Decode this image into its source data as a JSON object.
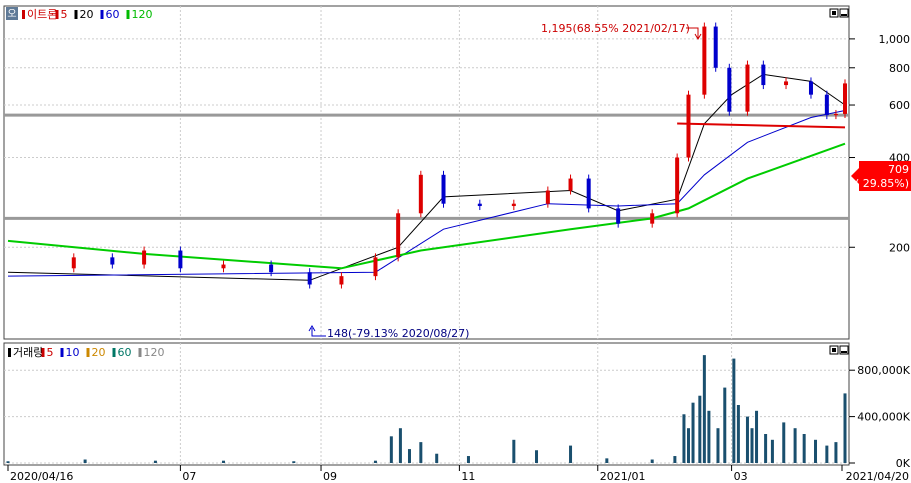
{
  "price_panel": {
    "badge": "오",
    "legend": [
      {
        "label": "이트론",
        "color": "#cc0000"
      },
      {
        "label": "5",
        "color": "#cc0000"
      },
      {
        "label": "20",
        "color": "#000000"
      },
      {
        "label": "60",
        "color": "#0000cc"
      },
      {
        "label": "120",
        "color": "#00bb00"
      }
    ],
    "current_price": "709",
    "current_change": "( 29.85%)",
    "high_annotation": "1,195(68.55% 2021/02/17)",
    "low_annotation": "148(-79.13% 2020/08/27)"
  },
  "volume_panel": {
    "legend": [
      {
        "label": "거래량",
        "color": "#000000"
      },
      {
        "label": "5",
        "color": "#cc0000"
      },
      {
        "label": "10",
        "color": "#0000cc"
      },
      {
        "label": "20",
        "color": "#cc8800"
      },
      {
        "label": "60",
        "color": "#007766"
      },
      {
        "label": "120",
        "color": "#888888"
      }
    ]
  },
  "x_axis_labels": [
    "2020/04/16",
    "07",
    "09",
    "11",
    "2021/01",
    "03",
    "2021/04/20"
  ],
  "colors": {
    "up": "#dd0000",
    "down": "#0000cc",
    "ma5": "#dd0000",
    "ma20": "#000000",
    "ma60": "#0000cc",
    "ma120": "#00cc00",
    "volume_bar": "#1a4f6e",
    "horizontal_line": "#999999"
  },
  "chart_data": [
    {
      "type": "candlestick",
      "title": "이트론",
      "ylim": [
        100,
        1250
      ],
      "yticks": [
        200,
        400,
        600,
        800,
        1000
      ],
      "ytick_labels": [
        "200",
        "400",
        "600",
        "800",
        "1,000"
      ],
      "horizontal_lines": [
        555,
        250
      ],
      "series_close": [
        [
          "2020/04/16",
          170
        ],
        [
          "2020/05/15",
          185
        ],
        [
          "2020/06/01",
          175
        ],
        [
          "2020/06/15",
          195
        ],
        [
          "2020/07/01",
          170
        ],
        [
          "2020/07/20",
          175
        ],
        [
          "2020/08/10",
          165
        ],
        [
          "2020/08/27",
          150
        ],
        [
          "2020/09/10",
          160
        ],
        [
          "2020/09/25",
          185
        ],
        [
          "2020/10/05",
          260
        ],
        [
          "2020/10/15",
          350
        ],
        [
          "2020/10/25",
          280
        ],
        [
          "2020/11/10",
          275
        ],
        [
          "2020/11/25",
          280
        ],
        [
          "2020/12/10",
          310
        ],
        [
          "2020/12/20",
          340
        ],
        [
          "2020/12/28",
          270
        ],
        [
          "2021/01/10",
          240
        ],
        [
          "2021/01/25",
          260
        ],
        [
          "2021/02/05",
          400
        ],
        [
          "2021/02/10",
          650
        ],
        [
          "2021/02/17",
          1100
        ],
        [
          "2021/02/22",
          800
        ],
        [
          "2021/02/28",
          570
        ],
        [
          "2021/03/08",
          820
        ],
        [
          "2021/03/15",
          700
        ],
        [
          "2021/03/25",
          720
        ],
        [
          "2021/04/05",
          650
        ],
        [
          "2021/04/12",
          555
        ],
        [
          "2021/04/16",
          560
        ],
        [
          "2021/04/20",
          709
        ]
      ],
      "moving_averages": [
        {
          "name": "20",
          "points": [
            [
              "2020/04/16",
              165
            ],
            [
              "2020/08/27",
              155
            ],
            [
              "2020/10/05",
              200
            ],
            [
              "2020/10/25",
              295
            ],
            [
              "2020/12/20",
              310
            ],
            [
              "2021/01/10",
              265
            ],
            [
              "2021/02/05",
              290
            ],
            [
              "2021/02/17",
              520
            ],
            [
              "2021/03/01",
              650
            ],
            [
              "2021/03/15",
              760
            ],
            [
              "2021/04/05",
              720
            ],
            [
              "2021/04/20",
              600
            ]
          ]
        },
        {
          "name": "60",
          "points": [
            [
              "2020/04/16",
              160
            ],
            [
              "2020/09/25",
              165
            ],
            [
              "2020/10/25",
              230
            ],
            [
              "2020/12/10",
              280
            ],
            [
              "2021/01/10",
              275
            ],
            [
              "2021/02/05",
              280
            ],
            [
              "2021/02/17",
              350
            ],
            [
              "2021/03/08",
              450
            ],
            [
              "2021/04/05",
              545
            ],
            [
              "2021/04/20",
              575
            ]
          ]
        },
        {
          "name": "120",
          "points": [
            [
              "2020/04/16",
              210
            ],
            [
              "2020/06/15",
              190
            ],
            [
              "2020/09/10",
              170
            ],
            [
              "2020/10/15",
              195
            ],
            [
              "2020/12/20",
              230
            ],
            [
              "2021/01/25",
              250
            ],
            [
              "2021/02/10",
              270
            ],
            [
              "2021/03/08",
              340
            ],
            [
              "2021/04/20",
              445
            ]
          ]
        }
      ],
      "high": {
        "date": "2021/02/17",
        "value": 1195
      },
      "low": {
        "date": "2020/08/27",
        "value": 148
      }
    },
    {
      "type": "bar",
      "title": "거래량",
      "ylim": [
        0,
        1000000
      ],
      "yticks": [
        0,
        400000,
        800000
      ],
      "ytick_labels": [
        "0K",
        "400,000K",
        "800,000K"
      ],
      "x": [
        "2020/04/16",
        "2020/05/20",
        "2020/06/20",
        "2020/07/20",
        "2020/08/20",
        "2020/09/25",
        "2020/10/02",
        "2020/10/06",
        "2020/10/10",
        "2020/10/15",
        "2020/10/22",
        "2020/11/05",
        "2020/11/25",
        "2020/12/05",
        "2020/12/20",
        "2021/01/05",
        "2021/01/25",
        "2021/02/04",
        "2021/02/08",
        "2021/02/10",
        "2021/02/12",
        "2021/02/15",
        "2021/02/17",
        "2021/02/19",
        "2021/02/23",
        "2021/02/26",
        "2021/03/02",
        "2021/03/04",
        "2021/03/08",
        "2021/03/10",
        "2021/03/12",
        "2021/03/16",
        "2021/03/19",
        "2021/03/24",
        "2021/03/29",
        "2021/04/02",
        "2021/04/07",
        "2021/04/12",
        "2021/04/16",
        "2021/04/20"
      ],
      "values": [
        15000,
        30000,
        20000,
        20000,
        15000,
        20000,
        230000,
        300000,
        120000,
        180000,
        80000,
        60000,
        200000,
        110000,
        150000,
        40000,
        30000,
        60000,
        420000,
        300000,
        520000,
        580000,
        930000,
        450000,
        300000,
        650000,
        900000,
        500000,
        400000,
        300000,
        450000,
        250000,
        200000,
        350000,
        300000,
        250000,
        200000,
        150000,
        180000,
        600000
      ]
    }
  ]
}
